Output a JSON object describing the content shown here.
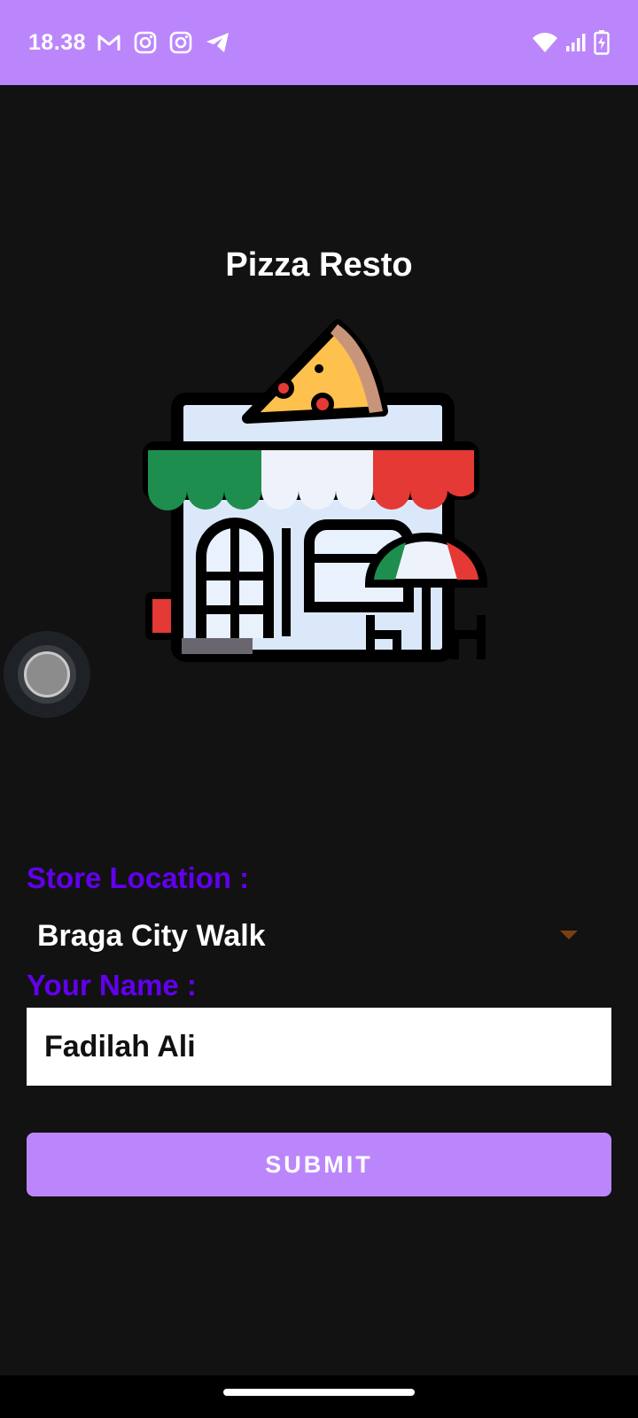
{
  "status_bar": {
    "time": "18.38",
    "left_icons": [
      "gmail-icon",
      "instagram-icon",
      "instagram-icon",
      "telegram-icon"
    ],
    "right_icons": [
      "wifi-icon",
      "signal-icon",
      "battery-charging-icon"
    ],
    "background": "#bb86fc"
  },
  "app": {
    "title": "Pizza Resto",
    "illustration": "pizza-restaurant-storefront"
  },
  "form": {
    "store_location_label": "Store Location :",
    "store_location_value": "Braga City Walk",
    "name_label": "Your Name :",
    "name_value": "Fadilah Ali",
    "submit_label": "SUBMIT"
  },
  "colors": {
    "accent": "#bb86fc",
    "label": "#6200ee",
    "background": "#121212"
  }
}
